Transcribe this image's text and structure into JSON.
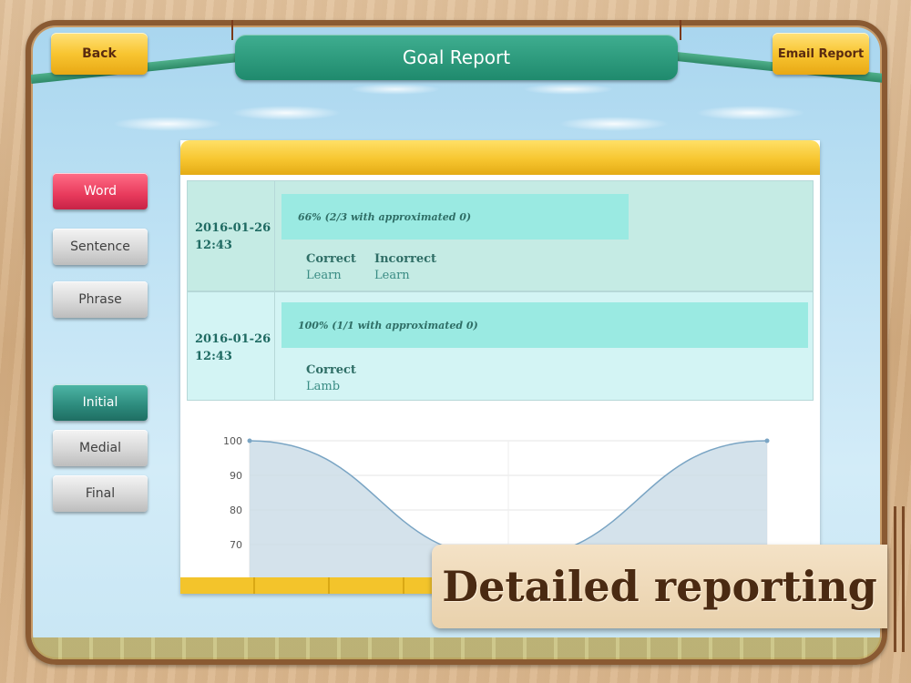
{
  "header": {
    "back_label": "Back",
    "title": "Goal Report",
    "email_label": "Email Report"
  },
  "sidebar": {
    "categories": [
      {
        "label": "Word",
        "state": "selected"
      },
      {
        "label": "Sentence",
        "state": "normal"
      },
      {
        "label": "Phrase",
        "state": "normal"
      }
    ],
    "positions": [
      {
        "label": "Initial",
        "state": "selected"
      },
      {
        "label": "Medial",
        "state": "normal"
      },
      {
        "label": "Final",
        "state": "normal"
      }
    ]
  },
  "report": {
    "entries": [
      {
        "date": "2016-01-26",
        "time": "12:43",
        "score_text": "66% (2/3 with approximated 0)",
        "score_fraction": 0.66,
        "correct_header": "Correct",
        "correct_words": [
          "Learn"
        ],
        "incorrect_header": "Incorrect",
        "incorrect_words": [
          "Learn"
        ]
      },
      {
        "date": "2016-01-26",
        "time": "12:43",
        "score_text": "100% (1/1 with approximated 0)",
        "score_fraction": 1.0,
        "correct_header": "Correct",
        "correct_words": [
          "Lamb"
        ]
      }
    ]
  },
  "chart_data": {
    "type": "area",
    "x": [
      1,
      2,
      3
    ],
    "series": [
      {
        "values": [
          100,
          66,
          100
        ]
      }
    ],
    "y_ticks": [
      100,
      90,
      80,
      70
    ],
    "ylim_visible": [
      66,
      100
    ],
    "grid": true
  },
  "caption": "Detailed reporting",
  "colors": {
    "accent_teal": "#1f8a6d",
    "accent_gold": "#f8c531",
    "selected_red": "#e83a5c",
    "chart_fill": "#c9dbe6",
    "chart_line": "#7aa5c4"
  }
}
